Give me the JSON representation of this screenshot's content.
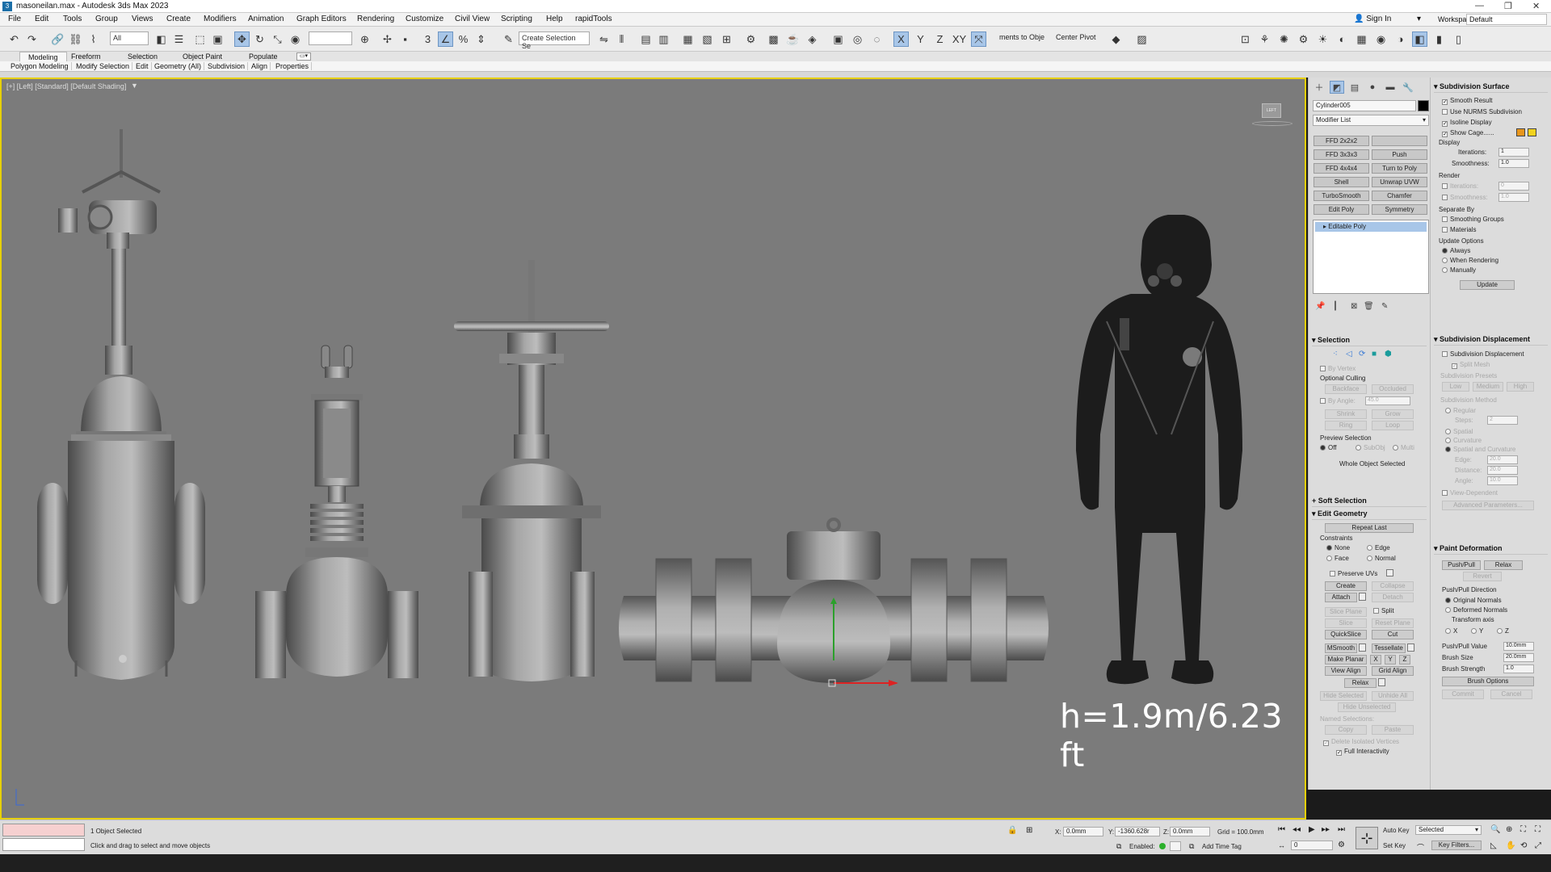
{
  "window": {
    "title": "masoneilan.max - Autodesk 3ds Max 2023",
    "minimize": "—",
    "restore": "❐",
    "close": "✕"
  },
  "menu": [
    "File",
    "Edit",
    "Tools",
    "Group",
    "Views",
    "Create",
    "Modifiers",
    "Animation",
    "Graph Editors",
    "Rendering",
    "Customize",
    "Civil View",
    "Scripting",
    "Help",
    "rapidTools"
  ],
  "account": {
    "sign_in": "Sign In",
    "workspaces_label": "Workspaces:",
    "workspace": "Default"
  },
  "toolbar": {
    "filter": "All",
    "selection_set": "Create Selection Se",
    "align_text": "ments to Obje",
    "pivot_text": "Center Pivot",
    "axis_x": "X",
    "axis_y": "Y",
    "axis_z": "Z",
    "axis_xy": "XY"
  },
  "ribbon": {
    "tabs": [
      "Modeling",
      "Freeform",
      "Selection",
      "Object Paint",
      "Populate"
    ],
    "subtabs": [
      "Polygon Modeling",
      "Modify Selection",
      "Edit",
      "Geometry (All)",
      "Subdivision",
      "Align",
      "Properties"
    ]
  },
  "viewport": {
    "label": "[+] [Left] [Standard] [Default Shading]",
    "viewcube_label": "LEFT",
    "dimension_text": "h=1.9m/6.23 ft"
  },
  "command_panel": {
    "object_name": "Cylinder005",
    "object_color": "#000000",
    "modifier_list": "Modifier List",
    "modifier_buttons": [
      [
        "FFD 2x2x2",
        ""
      ],
      [
        "FFD 3x3x3",
        "Push"
      ],
      [
        "FFD 4x4x4",
        "Turn to Poly"
      ],
      [
        "Shell",
        "Unwrap UVW"
      ],
      [
        "TurboSmooth",
        "Chamfer"
      ],
      [
        "Edit Poly",
        "Symmetry"
      ]
    ],
    "stack_item": "Editable Poly",
    "selection": {
      "title": "Selection",
      "by_vertex": "By Vertex",
      "ignore_backfacing": "Optional Culling",
      "backface": "Backface",
      "occluded": "Occluded",
      "by_angle": "By Angle:",
      "angle_value": "45.0",
      "shrink": "Shrink",
      "grow": "Grow",
      "ring": "Ring",
      "loop": "Loop",
      "preview_selection": "Preview Selection",
      "off": "Off",
      "subobj": "SubObj",
      "multi": "Multi",
      "whole_object": "Whole Object Selected"
    },
    "soft_selection": "Soft Selection",
    "edit_geometry": {
      "title": "Edit Geometry",
      "repeat_last": "Repeat Last",
      "constraints": "Constraints",
      "none": "None",
      "edge": "Edge",
      "face": "Face",
      "normal": "Normal",
      "preserve_uvs": "Preserve UVs",
      "create": "Create",
      "collapse": "Collapse",
      "attach": "Attach",
      "detach": "Detach",
      "slice_plane": "Slice Plane",
      "split": "Split",
      "slice": "Slice",
      "reset_plane": "Reset Plane",
      "quickslice": "QuickSlice",
      "cut": "Cut",
      "msmooth": "MSmooth",
      "tessellate": "Tessellate",
      "make_planar": "Make Planar",
      "x": "X",
      "y": "Y",
      "z": "Z",
      "view_align": "View Align",
      "grid_align": "Grid Align",
      "relax": "Relax",
      "hide_selected": "Hide Selected",
      "unhide_all": "Unhide All",
      "hide_unselected": "Hide Unselected",
      "named_selections": "Named Selections:",
      "copy": "Copy",
      "paste": "Paste",
      "delete_isolated": "Delete Isolated Vertices",
      "full_interactivity": "Full Interactivity"
    }
  },
  "modifier_panel": {
    "subdivision_surface": {
      "title": "Subdivision Surface",
      "smooth_result": "Smooth Result",
      "use_nurms": "Use NURMS Subdivision",
      "isoline": "Isoline Display",
      "show_cage": "Show Cage......",
      "cage_color_1": "#e8961c",
      "cage_color_2": "#f2d21d",
      "display": "Display",
      "iterations": "Iterations:",
      "iterations_value": "1",
      "smoothness": "Smoothness:",
      "smoothness_value": "1.0",
      "render": "Render",
      "r_iterations_value": "0",
      "r_smoothness_value": "1.0",
      "separate_by": "Separate By",
      "smoothing_groups": "Smoothing Groups",
      "materials": "Materials",
      "update_options": "Update Options",
      "always": "Always",
      "when_rendering": "When Rendering",
      "manually": "Manually",
      "update": "Update"
    },
    "subdivision_displacement": {
      "title": "Subdivision Displacement",
      "sub_disp": "Subdivision Displacement",
      "split_mesh": "Split Mesh",
      "presets": "Subdivision Presets",
      "low": "Low",
      "medium": "Medium",
      "high": "High",
      "method": "Subdivision Method",
      "regular": "Regular",
      "steps": "Steps:",
      "steps_value": "2",
      "spatial": "Spatial",
      "curvature": "Curvature",
      "spatial_curv": "Spatial and Curvature",
      "edge": "Edge:",
      "edge_value": "20.0",
      "distance": "Distance:",
      "distance_value": "20.0",
      "angle": "Angle:",
      "angle_value": "10.0",
      "view_dependent": "View-Dependent",
      "advanced": "Advanced Parameters..."
    },
    "paint_deformation": {
      "title": "Paint Deformation",
      "push_pull": "Push/Pull",
      "relax": "Relax",
      "revert": "Revert",
      "direction": "Push/Pull Direction",
      "original_normals": "Original Normals",
      "deformed_normals": "Deformed Normals",
      "transform_axis": "Transform axis",
      "x": "X",
      "y": "Y",
      "z": "Z",
      "pp_value": "Push/Pull Value",
      "pp_value_v": "10.0mm",
      "brush_size": "Brush Size",
      "brush_size_v": "20.0mm",
      "brush_strength": "Brush Strength",
      "brush_strength_v": "1.0",
      "brush_options": "Brush Options",
      "commit": "Commit",
      "cancel": "Cancel"
    }
  },
  "status": {
    "selected": "1 Object Selected",
    "prompt": "Click and drag to select and move objects",
    "x_label": "X:",
    "x_value": "0.0mm",
    "y_label": "Y:",
    "y_value": "-1360.628r",
    "z_label": "Z:",
    "z_value": "0.0mm",
    "grid": "Grid = 100.0mm",
    "enabled": "Enabled:",
    "frame": "0",
    "add_time_tag": "Add Time Tag",
    "auto_key": "Auto Key",
    "set_key": "Set Key",
    "key_mode": "Selected",
    "key_filters": "Key Filters..."
  }
}
